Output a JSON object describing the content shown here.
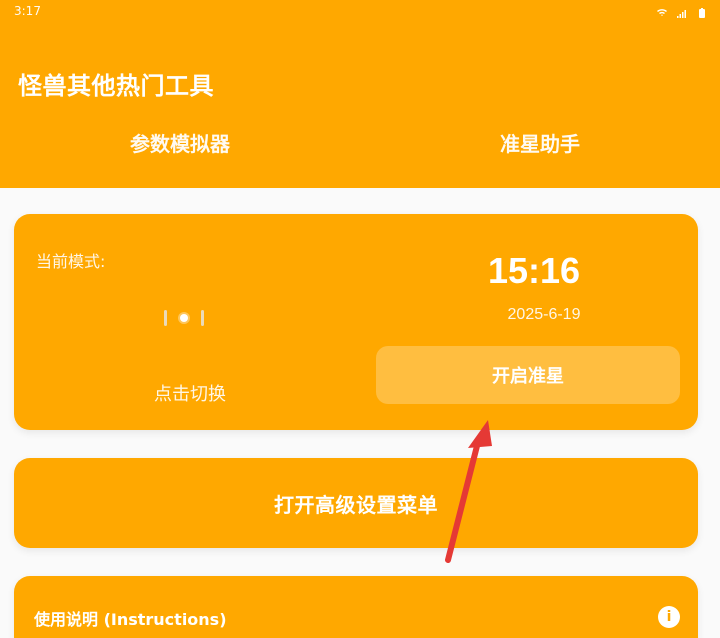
{
  "status_bar": {
    "time": "3:17",
    "icons": [
      "wifi-icon",
      "signal-icon",
      "battery-icon"
    ]
  },
  "header": {
    "title": "怪兽其他热门工具",
    "tabs": [
      {
        "label": "参数模拟器"
      },
      {
        "label": "准星助手"
      }
    ]
  },
  "main_card": {
    "current_mode_label": "当前模式:",
    "click_to_switch": "点击切换",
    "time": "15:16",
    "date": "2025-6-19",
    "aim_button_label": "开启准星"
  },
  "menu_card": {
    "label": "打开高级设置菜单"
  },
  "info_card": {
    "title": "使用说明 (Instructions)",
    "icon": "info-icon"
  },
  "colors": {
    "primary": "#FFA800",
    "accent_arrow": "#E53935"
  }
}
